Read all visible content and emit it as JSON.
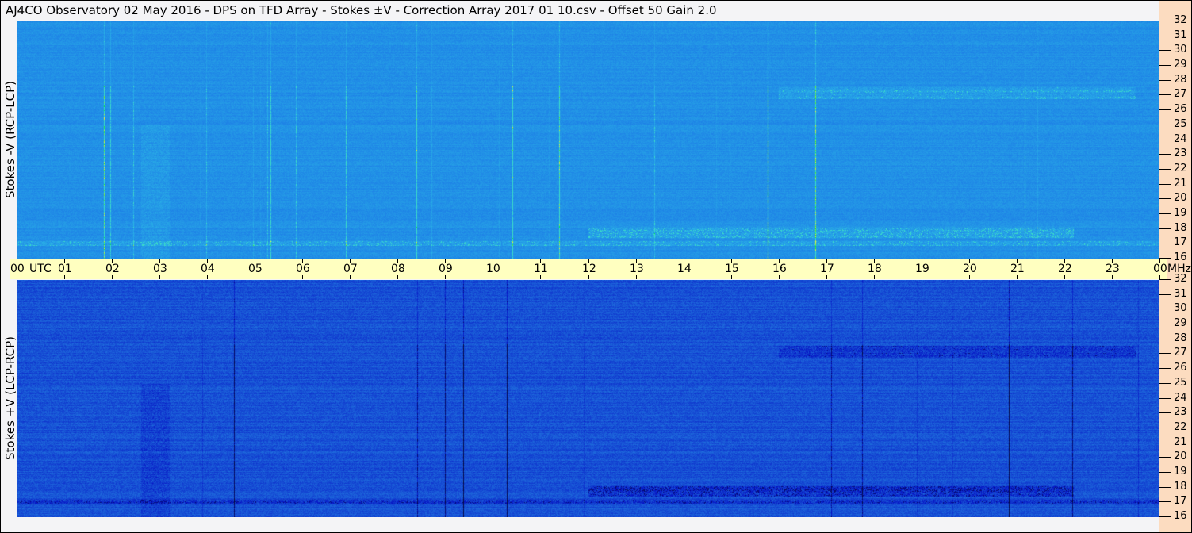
{
  "title": "AJ4CO Observatory  02 May 2016  -  DPS on TFD Array  -  Stokes ±V  -  Correction Array 2017 01 10.csv  -  Offset 50  Gain 2.0",
  "colors": {
    "background_top": "#2a7ae8",
    "background_bottom": "#1f56d4",
    "time_band": "#ffffc0",
    "freq_panel": "#fcdcc0"
  },
  "chart_data": [
    {
      "type": "heatmap",
      "name": "Stokes -V (RCP-LCP)",
      "ylabel": "Stokes -V  (RCP-LCP)",
      "xlabel": "UTC",
      "yunit": "MHz",
      "x_range": [
        0,
        24
      ],
      "y_range": [
        16,
        32
      ],
      "x_ticks": [
        "00",
        "01",
        "02",
        "03",
        "04",
        "05",
        "06",
        "07",
        "08",
        "09",
        "10",
        "11",
        "12",
        "13",
        "14",
        "15",
        "16",
        "17",
        "18",
        "19",
        "20",
        "21",
        "22",
        "23",
        "00"
      ],
      "y_ticks": [
        16,
        17,
        18,
        19,
        20,
        21,
        22,
        23,
        24,
        25,
        26,
        27,
        28,
        29,
        30,
        31,
        32
      ]
    },
    {
      "type": "heatmap",
      "name": "Stokes +V (LCP-RCP)",
      "ylabel": "Stokes +V  (LCP-RCP)",
      "xlabel": "UTC",
      "yunit": "MHz",
      "x_range": [
        0,
        24
      ],
      "y_range": [
        16,
        32
      ],
      "x_ticks": [
        "00",
        "01",
        "02",
        "03",
        "04",
        "05",
        "06",
        "07",
        "08",
        "09",
        "10",
        "11",
        "12",
        "13",
        "14",
        "15",
        "16",
        "17",
        "18",
        "19",
        "20",
        "21",
        "22",
        "23",
        "00"
      ],
      "y_ticks": [
        16,
        17,
        18,
        19,
        20,
        21,
        22,
        23,
        24,
        25,
        26,
        27,
        28,
        29,
        30,
        31,
        32
      ]
    }
  ],
  "axis": {
    "utc_label": "UTC",
    "mhz_label": "MHz"
  }
}
